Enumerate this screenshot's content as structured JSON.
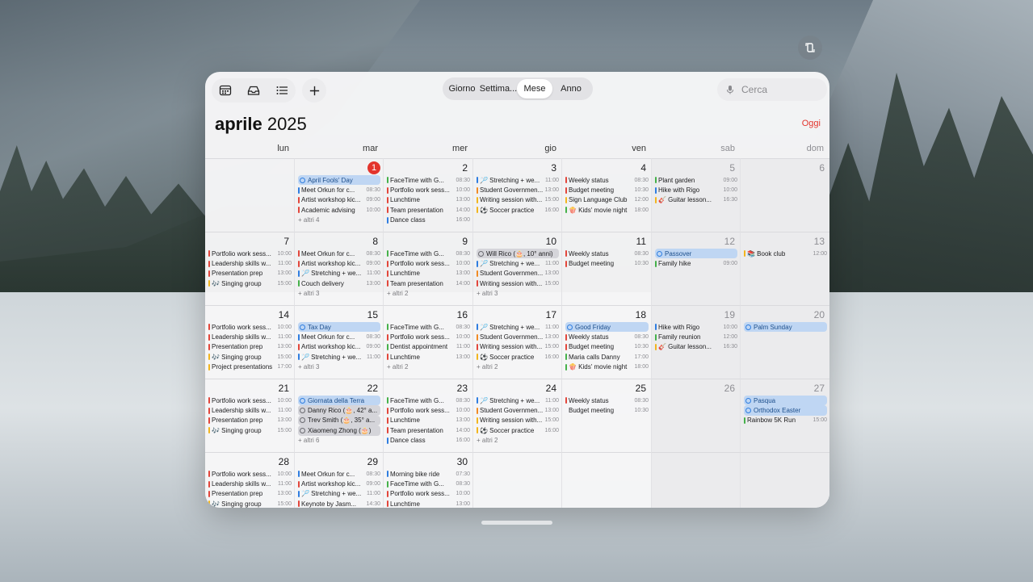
{
  "toolbar": {
    "icons": [
      "calendar-icon",
      "inbox-icon",
      "list-icon"
    ],
    "add_icon": "plus-icon"
  },
  "view_switcher": {
    "items": [
      "Giorno",
      "Settima...",
      "Mese",
      "Anno"
    ],
    "active": "Mese"
  },
  "search": {
    "placeholder": "Cerca",
    "icon": "microphone-icon"
  },
  "header": {
    "month": "aprile",
    "year": "2025",
    "today_button": "Oggi"
  },
  "weekdays": [
    "lun",
    "mar",
    "mer",
    "gio",
    "ven",
    "sab",
    "dom"
  ],
  "colors": {
    "red": "#e2463b",
    "blue": "#2f7de0",
    "green": "#45b14a",
    "yellow": "#f2b51e",
    "orange": "#f08a24",
    "purple": "#a45bd6",
    "today": "#e3342c"
  },
  "today_date": "1",
  "weeks": [
    [
      {
        "day": "",
        "events": []
      },
      {
        "day": "1",
        "today": true,
        "events": [
          {
            "type": "pill",
            "style": "blue",
            "title": "April Fools' Day"
          },
          {
            "c": "blue",
            "title": "Meet Orkun for c...",
            "time": "08:30"
          },
          {
            "c": "red",
            "title": "Artist workshop kic...",
            "time": "09:00"
          },
          {
            "c": "red",
            "title": "Academic advising",
            "time": "10:00"
          }
        ],
        "more": "+ altri 4"
      },
      {
        "day": "2",
        "events": [
          {
            "c": "green",
            "title": "FaceTime with G...",
            "time": "08:30"
          },
          {
            "c": "red",
            "title": "Portfolio work sess...",
            "time": "10:00"
          },
          {
            "c": "red",
            "title": "Lunchtime",
            "time": "13:00"
          },
          {
            "c": "red",
            "title": "Team presentation",
            "time": "14:00"
          },
          {
            "c": "blue",
            "title": "Dance class",
            "time": "16:00"
          }
        ]
      },
      {
        "day": "3",
        "events": [
          {
            "c": "blue",
            "title": "🏸 Stretching + we...",
            "time": "11:00"
          },
          {
            "c": "orange",
            "title": "Student Governmen...",
            "time": "13:00"
          },
          {
            "c": "yellow",
            "title": "Writing session with...",
            "time": "15:00"
          },
          {
            "c": "yellow",
            "title": "⚽ Soccer practice",
            "time": "16:00"
          }
        ]
      },
      {
        "day": "4",
        "events": [
          {
            "c": "red",
            "title": "Weekly status",
            "time": "08:30"
          },
          {
            "c": "red",
            "title": "Budget meeting",
            "time": "10:30"
          },
          {
            "c": "yellow",
            "title": "Sign Language Club",
            "time": "12:00"
          },
          {
            "c": "green",
            "title": "🍿 Kids' movie night",
            "time": "18:00"
          }
        ]
      },
      {
        "day": "5",
        "we": true,
        "events": [
          {
            "c": "green",
            "title": "Plant garden",
            "time": "09:00"
          },
          {
            "c": "blue",
            "title": "Hike with Rigo",
            "time": "10:00"
          },
          {
            "c": "yellow",
            "title": "🎸 Guitar lesson...",
            "time": "16:30"
          }
        ]
      },
      {
        "day": "6",
        "we": true,
        "events": []
      }
    ],
    [
      {
        "day": "7",
        "events": [
          {
            "c": "red",
            "title": "Portfolio work sess...",
            "time": "10:00"
          },
          {
            "c": "red",
            "title": "Leadership skills w...",
            "time": "11:00"
          },
          {
            "c": "red",
            "title": "Presentation prep",
            "time": "13:00"
          },
          {
            "c": "yellow",
            "title": "🎶 Singing group",
            "time": "15:00"
          }
        ]
      },
      {
        "day": "8",
        "events": [
          {
            "c": "red",
            "title": "Meet Orkun for c...",
            "time": "08:30"
          },
          {
            "c": "red",
            "title": "Artist workshop kic...",
            "time": "09:00"
          },
          {
            "c": "blue",
            "title": "🏸 Stretching + we...",
            "time": "11:00"
          },
          {
            "c": "green",
            "title": "Couch delivery",
            "time": "13:00"
          }
        ],
        "more": "+ altri 3"
      },
      {
        "day": "9",
        "events": [
          {
            "c": "green",
            "title": "FaceTime with G...",
            "time": "08:30"
          },
          {
            "c": "red",
            "title": "Portfolio work sess...",
            "time": "10:00"
          },
          {
            "c": "red",
            "title": "Lunchtime",
            "time": "13:00"
          },
          {
            "c": "red",
            "title": "Team presentation",
            "time": "14:00"
          }
        ],
        "more": "+ altri 2"
      },
      {
        "day": "10",
        "events": [
          {
            "type": "pill",
            "style": "gray",
            "title": "Will Rico (🎂, 10° anni)"
          },
          {
            "c": "blue",
            "title": "🏸 Stretching + we...",
            "time": "11:00"
          },
          {
            "c": "orange",
            "title": "Student Governmen...",
            "time": "13:00"
          },
          {
            "c": "red",
            "title": "Writing session with...",
            "time": "15:00"
          }
        ],
        "more": "+ altri 3"
      },
      {
        "day": "11",
        "events": [
          {
            "c": "red",
            "title": "Weekly status",
            "time": "08:30"
          },
          {
            "c": "red",
            "title": "Budget meeting",
            "time": "10:30"
          }
        ]
      },
      {
        "day": "12",
        "we": true,
        "events": [
          {
            "type": "pill",
            "style": "blue",
            "title": "Passover"
          },
          {
            "c": "green",
            "title": "Family hike",
            "time": "09:00"
          }
        ]
      },
      {
        "day": "13",
        "we": true,
        "events": [
          {
            "c": "yellow",
            "title": "📚 Book club",
            "time": "12:00"
          }
        ]
      }
    ],
    [
      {
        "day": "14",
        "events": [
          {
            "c": "red",
            "title": "Portfolio work sess...",
            "time": "10:00"
          },
          {
            "c": "red",
            "title": "Leadership skills w...",
            "time": "11:00"
          },
          {
            "c": "red",
            "title": "Presentation prep",
            "time": "13:00"
          },
          {
            "c": "yellow",
            "title": "🎶 Singing group",
            "time": "15:00"
          },
          {
            "c": "yellow",
            "title": "Project presentations",
            "time": "17:00"
          }
        ]
      },
      {
        "day": "15",
        "events": [
          {
            "type": "pill",
            "style": "blue",
            "title": "Tax Day"
          },
          {
            "c": "blue",
            "title": "Meet Orkun for c...",
            "time": "08:30"
          },
          {
            "c": "red",
            "title": "Artist workshop kic...",
            "time": "09:00"
          },
          {
            "c": "blue",
            "title": "🏸 Stretching + we...",
            "time": "11:00"
          }
        ],
        "more": "+ altri 3"
      },
      {
        "day": "16",
        "events": [
          {
            "c": "green",
            "title": "FaceTime with G...",
            "time": "08:30"
          },
          {
            "c": "red",
            "title": "Portfolio work sess...",
            "time": "10:00"
          },
          {
            "c": "green",
            "title": "Dentist appointment",
            "time": "11:00"
          },
          {
            "c": "red",
            "title": "Lunchtime",
            "time": "13:00"
          }
        ],
        "more": "+ altri 2"
      },
      {
        "day": "17",
        "events": [
          {
            "c": "blue",
            "title": "🏸 Stretching + we...",
            "time": "11:00"
          },
          {
            "c": "orange",
            "title": "Student Governmen...",
            "time": "13:00"
          },
          {
            "c": "red",
            "title": "Writing session with...",
            "time": "15:00"
          },
          {
            "c": "yellow",
            "title": "⚽ Soccer practice",
            "time": "16:00"
          }
        ],
        "more": "+ altri 2"
      },
      {
        "day": "18",
        "events": [
          {
            "type": "pill",
            "style": "blue",
            "title": "Good Friday"
          },
          {
            "c": "red",
            "title": "Weekly status",
            "time": "08:30"
          },
          {
            "c": "red",
            "title": "Budget meeting",
            "time": "10:30"
          },
          {
            "c": "green",
            "title": "Maria calls Danny",
            "time": "17:00"
          },
          {
            "c": "green",
            "title": "🍿 Kids' movie night",
            "time": "18:00"
          }
        ]
      },
      {
        "day": "19",
        "we": true,
        "events": [
          {
            "c": "blue",
            "title": "Hike with Rigo",
            "time": "10:00"
          },
          {
            "c": "green",
            "title": "Family reunion",
            "time": "12:00"
          },
          {
            "c": "yellow",
            "title": "🎸 Guitar lesson...",
            "time": "16:30"
          }
        ]
      },
      {
        "day": "20",
        "we": true,
        "events": [
          {
            "type": "pill",
            "style": "blue",
            "title": "Palm Sunday"
          }
        ]
      }
    ],
    [
      {
        "day": "21",
        "events": [
          {
            "c": "red",
            "title": "Portfolio work sess...",
            "time": "10:00"
          },
          {
            "c": "red",
            "title": "Leadership skills w...",
            "time": "11:00"
          },
          {
            "c": "red",
            "title": "Presentation prep",
            "time": "13:00"
          },
          {
            "c": "yellow",
            "title": "🎶 Singing group",
            "time": "15:00"
          }
        ]
      },
      {
        "day": "22",
        "events": [
          {
            "type": "pill",
            "style": "blue",
            "title": "Giornata della Terra"
          },
          {
            "type": "pill",
            "style": "gray",
            "title": "Danny Rico (🎂, 42° a..."
          },
          {
            "type": "pill",
            "style": "gray",
            "title": "Trev Smith (🎂, 35° a..."
          },
          {
            "type": "pill",
            "style": "gray",
            "title": "Xiaomeng Zhong (🎂)"
          }
        ],
        "more": "+ altri 6"
      },
      {
        "day": "23",
        "events": [
          {
            "c": "green",
            "title": "FaceTime with G...",
            "time": "08:30"
          },
          {
            "c": "red",
            "title": "Portfolio work sess...",
            "time": "10:00"
          },
          {
            "c": "red",
            "title": "Lunchtime",
            "time": "13:00"
          },
          {
            "c": "red",
            "title": "Team presentation",
            "time": "14:00"
          },
          {
            "c": "blue",
            "title": "Dance class",
            "time": "16:00"
          }
        ]
      },
      {
        "day": "24",
        "events": [
          {
            "c": "blue",
            "title": "🏸 Stretching + we...",
            "time": "11:00"
          },
          {
            "c": "orange",
            "title": "Student Governmen...",
            "time": "13:00"
          },
          {
            "c": "yellow",
            "title": "Writing session with...",
            "time": "15:00"
          },
          {
            "c": "yellow",
            "title": "⚽ Soccer practice",
            "time": "16:00"
          }
        ],
        "more": "+ altri 2"
      },
      {
        "day": "25",
        "events": [
          {
            "c": "red",
            "title": "Weekly status",
            "time": "08:30"
          },
          {
            "c": "none",
            "title": "Budget meeting",
            "time": "10:30"
          }
        ]
      },
      {
        "day": "26",
        "we": true,
        "events": []
      },
      {
        "day": "27",
        "we": true,
        "events": [
          {
            "type": "pill",
            "style": "blue",
            "title": "Pasqua"
          },
          {
            "type": "pill",
            "style": "blue",
            "title": "Orthodox Easter"
          },
          {
            "c": "green",
            "title": "Rainbow 5K Run",
            "time": "15:00"
          }
        ]
      }
    ],
    [
      {
        "day": "28",
        "events": [
          {
            "c": "red",
            "title": "Portfolio work sess...",
            "time": "10:00"
          },
          {
            "c": "red",
            "title": "Leadership skills w...",
            "time": "11:00"
          },
          {
            "c": "red",
            "title": "Presentation prep",
            "time": "13:00"
          },
          {
            "c": "yellow",
            "title": "🎶 Singing group",
            "time": "15:00"
          }
        ]
      },
      {
        "day": "29",
        "events": [
          {
            "c": "blue",
            "title": "Meet Orkun for c...",
            "time": "08:30"
          },
          {
            "c": "red",
            "title": "Artist workshop kic...",
            "time": "09:00"
          },
          {
            "c": "blue",
            "title": "🏸 Stretching + we...",
            "time": "11:00"
          },
          {
            "c": "red",
            "title": "Keynote by Jasm...",
            "time": "14:30"
          }
        ]
      },
      {
        "day": "30",
        "events": [
          {
            "c": "blue",
            "title": "Morning bike ride",
            "time": "07:30"
          },
          {
            "c": "green",
            "title": "FaceTime with G...",
            "time": "08:30"
          },
          {
            "c": "red",
            "title": "Portfolio work sess...",
            "time": "10:00"
          },
          {
            "c": "red",
            "title": "Lunchtime",
            "time": "13:00"
          }
        ]
      },
      {
        "day": "",
        "events": []
      },
      {
        "day": "",
        "events": []
      },
      {
        "day": "",
        "we": true,
        "events": []
      },
      {
        "day": "",
        "we": true,
        "events": []
      }
    ]
  ]
}
